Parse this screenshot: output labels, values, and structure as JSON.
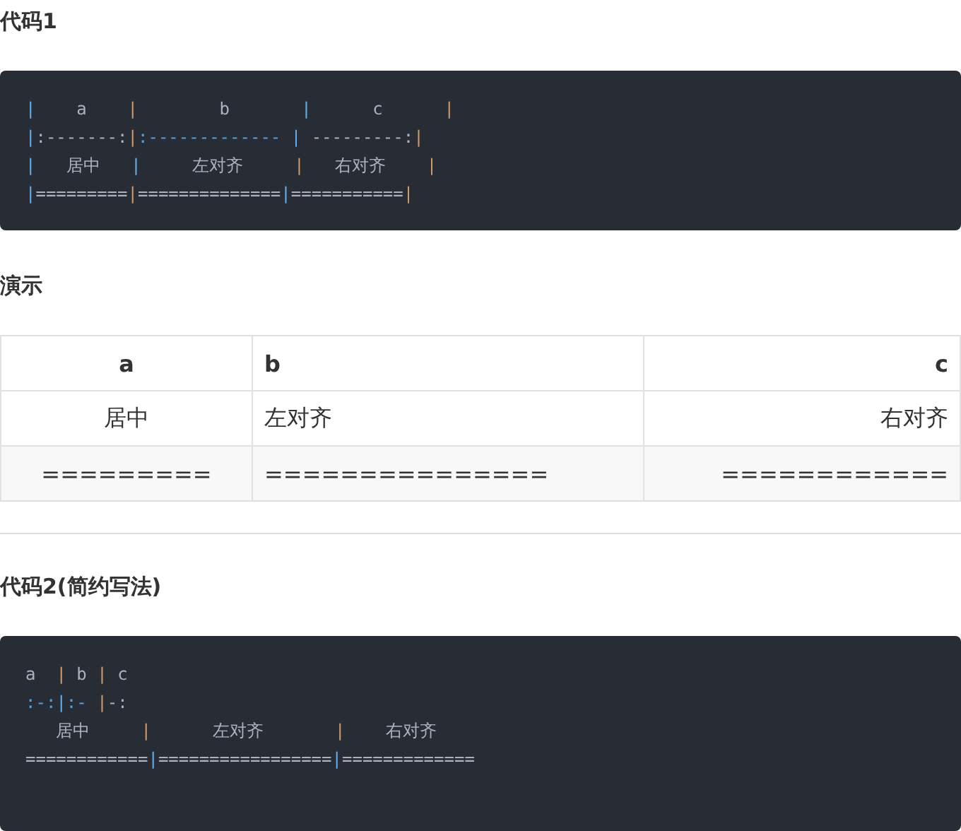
{
  "sections": [
    {
      "kind": "code",
      "heading": "代码1",
      "lines": [
        [
          {
            "text": "|",
            "kind": "pipe-blue"
          },
          {
            "text": "    a    ",
            "kind": "text"
          },
          {
            "text": "|",
            "kind": "pipe-orange"
          },
          {
            "text": "        b       ",
            "kind": "text"
          },
          {
            "text": "|",
            "kind": "pipe-blue"
          },
          {
            "text": "      c      ",
            "kind": "text"
          },
          {
            "text": "|",
            "kind": "pipe-orange"
          }
        ],
        [
          {
            "text": "|",
            "kind": "pipe-blue"
          },
          {
            "text": ":-------:",
            "kind": "text"
          },
          {
            "text": "|",
            "kind": "pipe-orange"
          },
          {
            "text": ":------------- ",
            "kind": "marker"
          },
          {
            "text": "|",
            "kind": "pipe-blue"
          },
          {
            "text": " ---------:",
            "kind": "text"
          },
          {
            "text": "|",
            "kind": "pipe-orange"
          }
        ],
        [
          {
            "text": "|",
            "kind": "pipe-blue"
          },
          {
            "text": "   居中   ",
            "kind": "text"
          },
          {
            "text": "|",
            "kind": "pipe-blue"
          },
          {
            "text": "     左对齐     ",
            "kind": "text"
          },
          {
            "text": "|",
            "kind": "pipe-orange"
          },
          {
            "text": "   右对齐    ",
            "kind": "text"
          },
          {
            "text": "|",
            "kind": "pipe-orange"
          }
        ],
        [
          {
            "text": "|",
            "kind": "pipe-blue"
          },
          {
            "text": "=========",
            "kind": "text"
          },
          {
            "text": "|",
            "kind": "pipe-orange"
          },
          {
            "text": "==============",
            "kind": "text"
          },
          {
            "text": "|",
            "kind": "pipe-blue"
          },
          {
            "text": "===========",
            "kind": "text"
          },
          {
            "text": "|",
            "kind": "pipe-orange"
          }
        ]
      ]
    },
    {
      "kind": "demo",
      "heading": "演示",
      "table": {
        "columns": [
          {
            "label": "a",
            "kind": "center"
          },
          {
            "label": "b",
            "kind": "left"
          },
          {
            "label": "c",
            "kind": "right"
          }
        ],
        "rows": [
          [
            "居中",
            "左对齐",
            "右对齐"
          ],
          [
            "=========",
            "===============",
            "============"
          ]
        ]
      }
    },
    {
      "kind": "code",
      "heading": "代码2(简约写法)",
      "lines": [
        [
          {
            "text": "a  ",
            "kind": "text"
          },
          {
            "text": "|",
            "kind": "pipe-orange"
          },
          {
            "text": " b ",
            "kind": "text"
          },
          {
            "text": "|",
            "kind": "pipe-orange"
          },
          {
            "text": " c",
            "kind": "text"
          }
        ],
        [
          {
            "text": ":-:",
            "kind": "marker"
          },
          {
            "text": "|",
            "kind": "pipe-blue"
          },
          {
            "text": ":- ",
            "kind": "marker"
          },
          {
            "text": "|",
            "kind": "pipe-orange"
          },
          {
            "text": "-:",
            "kind": "text"
          }
        ],
        [
          {
            "text": "   居中     ",
            "kind": "text"
          },
          {
            "text": "|",
            "kind": "pipe-orange"
          },
          {
            "text": "      左对齐       ",
            "kind": "text"
          },
          {
            "text": "|",
            "kind": "pipe-orange"
          },
          {
            "text": "    右对齐",
            "kind": "text"
          }
        ],
        [
          {
            "text": "============",
            "kind": "text"
          },
          {
            "text": "|",
            "kind": "pipe-blue"
          },
          {
            "text": "=================",
            "kind": "text"
          },
          {
            "text": "|",
            "kind": "pipe-blue"
          },
          {
            "text": "=============",
            "kind": "text"
          }
        ]
      ]
    }
  ]
}
